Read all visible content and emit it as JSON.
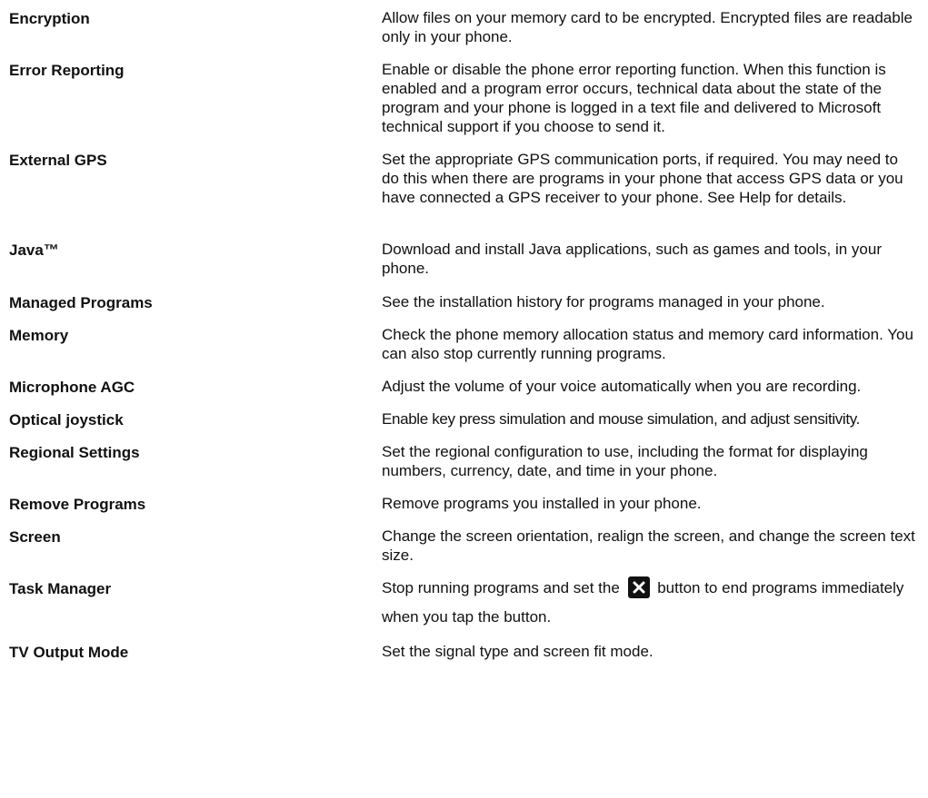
{
  "settings": [
    {
      "term": "Encryption",
      "desc": "Allow files on your memory card to be encrypted. Encrypted files are readable only in your phone."
    },
    {
      "term": "Error Reporting",
      "desc": "Enable or disable the phone error reporting function. When this function is enabled and a program error occurs, technical data about the state of the program and your phone is logged in a text file and delivered to Microsoft technical support if you choose to send it."
    },
    {
      "term": "External GPS",
      "desc": "Set the appropriate GPS communication ports, if required. You may need to do this when there are programs in your phone that access GPS data or you have connected a GPS receiver to your phone. See Help for details."
    },
    {
      "term": "Java™",
      "desc": "Download and install Java applications, such as games and tools, in your phone."
    },
    {
      "term": "Managed Programs",
      "desc": "See the installation history for programs managed in your phone."
    },
    {
      "term": "Memory",
      "desc": "Check the phone memory allocation status and memory card information. You can also stop currently running programs."
    },
    {
      "term": "Microphone AGC",
      "desc": "Adjust the volume of your voice automatically when you are recording."
    },
    {
      "term": "Optical joystick",
      "desc": "Enable key press simulation and mouse simulation, and adjust sensitivity."
    },
    {
      "term": "Regional Settings",
      "desc": "Set the regional configuration to use, including the format for displaying numbers, currency, date, and time in your phone."
    },
    {
      "term": "Remove Programs",
      "desc": "Remove programs you installed in your phone."
    },
    {
      "term": "Screen",
      "desc": "Change the screen orientation, realign the screen, and change the screen text size."
    },
    {
      "term": "Task Manager",
      "desc_before": "Stop running programs and set the",
      "desc_after": "button to end programs immediately when you tap the button.",
      "icon": "close-x-icon"
    },
    {
      "term": "TV Output Mode",
      "desc": "Set the signal type and screen fit mode."
    }
  ]
}
